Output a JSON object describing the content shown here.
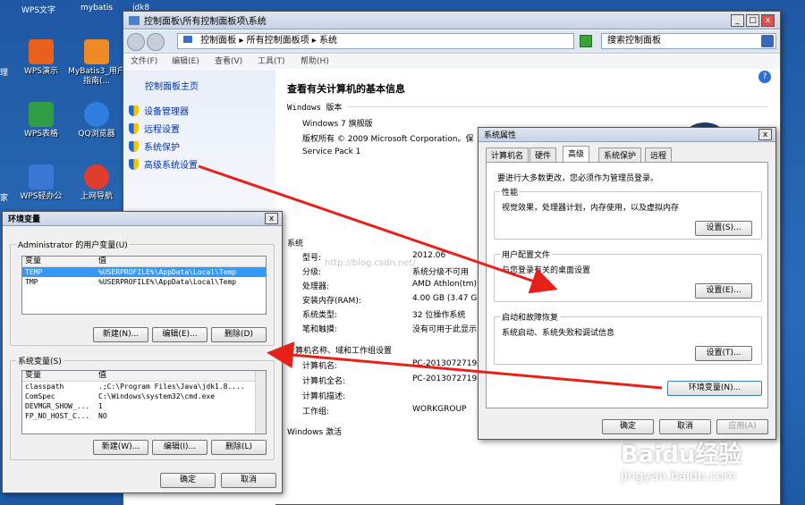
{
  "desktop": {
    "top_labels": [
      "WPS文字",
      "mybatis",
      "jdk8"
    ],
    "icons": [
      {
        "label": "WPS演示",
        "color": "#e8601c"
      },
      {
        "label": "MyBatis3_用户指南(...",
        "color": "#f08a24"
      },
      {
        "label": "WPS表格",
        "color": "#2f9c46"
      },
      {
        "label": "QQ浏览器",
        "color": "#2d7ee0"
      },
      {
        "label": "WPS轻办公",
        "color": "#3a78d6"
      },
      {
        "label": "上网导航",
        "color": "#e03d2f"
      }
    ],
    "left_edge_labels": [
      "理",
      "家"
    ]
  },
  "explorer": {
    "title": "控制面板\\所有控制面板项\\系统",
    "address": [
      "控制面板",
      "所有控制面板项",
      "系统"
    ],
    "search_placeholder": "搜索控制面板",
    "menu": [
      "文件(F)",
      "编辑(E)",
      "查看(V)",
      "工具(T)",
      "帮助(H)"
    ],
    "sidebar_home": "控制面板主页",
    "sidebar_links": [
      "设备管理器",
      "远程设置",
      "系统保护",
      "高级系统设置"
    ],
    "heading": "查看有关计算机的基本信息",
    "windows_edition_label": "Windows 版本",
    "edition": "Windows 7 旗舰版",
    "copyright": "版权所有 © 2009 Microsoft Corporation。保",
    "service_pack": "Service Pack 1",
    "system_label": "系统",
    "system_rows": [
      {
        "label": "型号:",
        "value": "2012.06"
      },
      {
        "label": "分级:",
        "value": "系统分级不可用"
      },
      {
        "label": "处理器:",
        "value": "AMD Athlon(tm)"
      },
      {
        "label": "安装内存(RAM):",
        "value": "4.00 GB (3.47 G"
      },
      {
        "label": "系统类型:",
        "value": "32 位操作系统"
      },
      {
        "label": "笔和触摸:",
        "value": "没有可用于此显示"
      }
    ],
    "computer_section_label": "计算机名称、域和工作组设置",
    "computer_rows": [
      {
        "label": "计算机名:",
        "value": "PC-20130727192B"
      },
      {
        "label": "计算机全名:",
        "value": "PC-20130727192B"
      },
      {
        "label": "计算机描述:",
        "value": ""
      },
      {
        "label": "工作组:",
        "value": "WORKGROUP"
      }
    ],
    "activation_label": "Windows 激活",
    "watermark": "http://blog.csdn.net/"
  },
  "sysprops": {
    "title": "系统属性",
    "tabs": [
      "计算机名",
      "硬件",
      "高级",
      "系统保护",
      "远程"
    ],
    "active_tab": "高级",
    "admin_note": "要进行大多数更改，您必须作为管理员登录。",
    "groups": [
      {
        "label": "性能",
        "desc": "视觉效果，处理器计划，内存使用，以及虚拟内存",
        "button": "设置(S)..."
      },
      {
        "label": "用户配置文件",
        "desc": "与您登录有关的桌面设置",
        "button": "设置(E)..."
      },
      {
        "label": "启动和故障恢复",
        "desc": "系统启动、系统失败和调试信息",
        "button": "设置(T)..."
      }
    ],
    "env_button": "环境变量(N)...",
    "ok": "确定",
    "cancel": "取消",
    "apply": "应用(A)"
  },
  "envvars": {
    "title": "环境变量",
    "user_group": "Administrator 的用户变量(U)",
    "col_var": "变量",
    "col_val": "值",
    "user_rows": [
      {
        "var": "TEMP",
        "val": "%USERPROFILE%\\AppData\\Local\\Temp"
      },
      {
        "var": "TMP",
        "val": "%USERPROFILE%\\AppData\\Local\\Temp"
      }
    ],
    "user_buttons": [
      "新建(N)...",
      "编辑(E)...",
      "删除(D)"
    ],
    "system_group": "系统变量(S)",
    "system_rows": [
      {
        "var": "classpath",
        "val": ".;C:\\Program Files\\Java\\jdk1.8...."
      },
      {
        "var": "ComSpec",
        "val": "C:\\Windows\\system32\\cmd.exe"
      },
      {
        "var": "DEVMGR_SHOW_...",
        "val": "1"
      },
      {
        "var": "FP_NO_HOST_C...",
        "val": "NO"
      }
    ],
    "system_buttons": [
      "新建(W)...",
      "编辑(I)...",
      "删除(L)"
    ],
    "ok": "确定",
    "cancel": "取消"
  },
  "baidu": {
    "logo": "Baidu经验",
    "url": "jingyan.baidu.com"
  }
}
